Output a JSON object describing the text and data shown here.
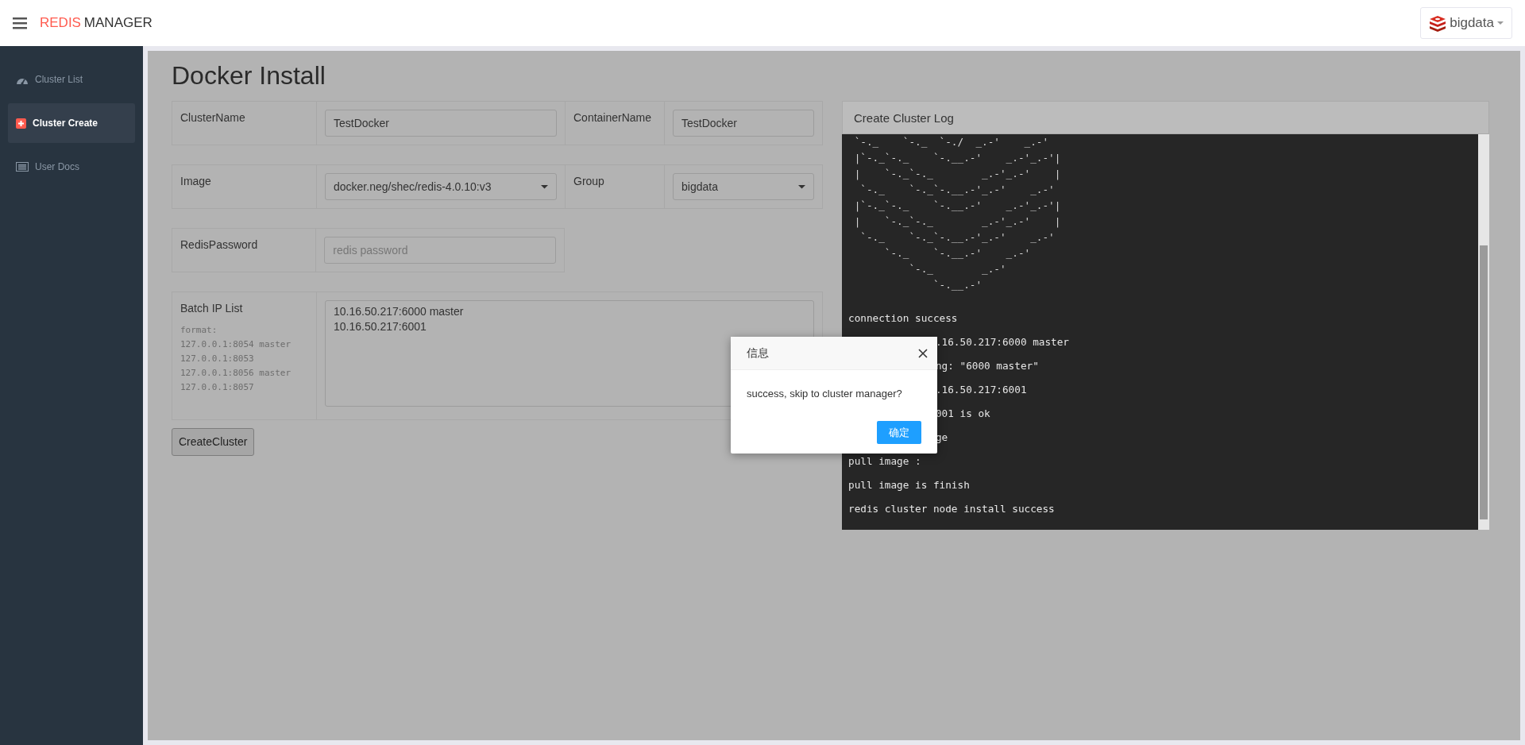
{
  "header": {
    "brand_accent": "REDIS",
    "brand": "MANAGER",
    "user": {
      "name": "bigdata"
    }
  },
  "sidebar": {
    "items": [
      {
        "label": "Cluster List",
        "selected": false
      },
      {
        "label": "Cluster Create",
        "selected": true
      },
      {
        "label": "User Docs",
        "selected": false
      }
    ]
  },
  "page": {
    "title": "Docker Install"
  },
  "form": {
    "rows": [
      {
        "fields": [
          {
            "label": "ClusterName",
            "kind": "text",
            "value": "TestDocker"
          },
          {
            "label": "ContainerName",
            "kind": "text",
            "value": "TestDocker"
          }
        ]
      },
      {
        "fields": [
          {
            "label": "Image",
            "kind": "select",
            "value": "docker.neg/shec/redis-4.0.10:v3"
          },
          {
            "label": "Group",
            "kind": "select",
            "value": "bigdata"
          }
        ]
      },
      {
        "fields": [
          {
            "label": "RedisPassword",
            "kind": "text",
            "placeholder": "redis password"
          }
        ]
      },
      {
        "fields": [
          {
            "label": "Batch IP List",
            "kind": "textarea",
            "hint": [
              "format:",
              "127.0.0.1:8054 master",
              "127.0.0.1:8053",
              "127.0.0.1:8056 master",
              "127.0.0.1:8057"
            ],
            "value": "10.16.50.217:6000 master\n10.16.50.217:6001"
          }
        ]
      }
    ],
    "submit": "CreateCluster"
  },
  "log": {
    "title": "Create Cluster Log",
    "lines": [
      {
        "kind": "art",
        "text": " `-._    `-._  `-./  _.-'    _.-'"
      },
      {
        "kind": "art",
        "text": " |`-._`-._    `-.__.-'    _.-'_.-'|"
      },
      {
        "kind": "art",
        "text": " |    `-._`-._        _.-'_.-'    |"
      },
      {
        "kind": "art",
        "text": "  `-._    `-._`-.__.-'_.-'    _.-'"
      },
      {
        "kind": "art",
        "text": " |`-._`-._    `-.__.-'    _.-'_.-'|"
      },
      {
        "kind": "art",
        "text": " |    `-._`-._        _.-'_.-'    |"
      },
      {
        "kind": "art",
        "text": "  `-._    `-._`-.__.-'_.-'    _.-'"
      },
      {
        "kind": "art",
        "text": "      `-._    `-.__.-'    _.-'"
      },
      {
        "kind": "art",
        "text": "          `-._        _.-'"
      },
      {
        "kind": "art",
        "text": "              `-.__.-'"
      },
      {
        "kind": "full",
        "text": "connection success"
      },
      {
        "kind": "covered",
        "text": ".16.50.217:6000 master"
      },
      {
        "kind": "covered",
        "text": "ng: \"6000 master\""
      },
      {
        "kind": "covered",
        "text": ".16.50.217:6001"
      },
      {
        "kind": "covered",
        "text": "001 is ok"
      },
      {
        "kind": "covered",
        "text": "ge"
      },
      {
        "kind": "full",
        "text": "pull image :"
      },
      {
        "kind": "full",
        "text": "pull image is finish"
      },
      {
        "kind": "full",
        "text": "redis cluster node install success"
      }
    ]
  },
  "dialog": {
    "title": "信息",
    "message": "success, skip to cluster manager?",
    "confirm": "确定"
  }
}
